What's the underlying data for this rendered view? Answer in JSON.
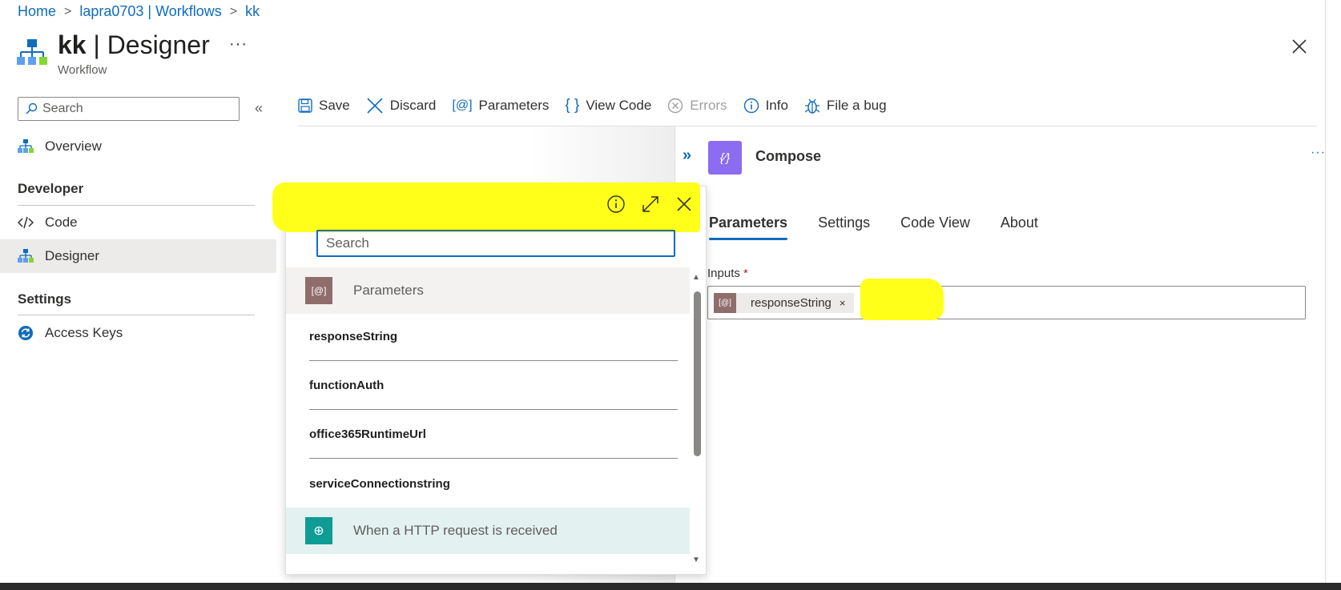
{
  "breadcrumb": {
    "items": [
      "Home",
      "lapra0703 | Workflows",
      "kk"
    ],
    "separator": ">"
  },
  "header": {
    "title_bold": "kk",
    "title_rest": " | Designer",
    "subtitle": "Workflow",
    "more": "···"
  },
  "sidebar": {
    "search_placeholder": "Search",
    "collapse": "«",
    "items": [
      {
        "label": "Overview",
        "icon": "hierarchy-icon"
      },
      {
        "label": "Code",
        "icon": "code-icon"
      },
      {
        "label": "Designer",
        "icon": "hierarchy-icon",
        "selected": true
      },
      {
        "label": "Access Keys",
        "icon": "sync-icon"
      }
    ],
    "sections": [
      "Developer",
      "Settings"
    ]
  },
  "toolbar": {
    "save": "Save",
    "discard": "Discard",
    "parameters": "Parameters",
    "parameters_icon_text": "[@]",
    "view_code": "View Code",
    "view_code_icon_text": "{ }",
    "errors": "Errors",
    "info": "Info",
    "file_bug": "File a bug"
  },
  "panel": {
    "title": "Compose",
    "icon_text": "{⁄}",
    "expand": "»",
    "more": "···",
    "tabs": [
      "Parameters",
      "Settings",
      "Code View",
      "About"
    ],
    "active_tab": "Parameters",
    "inputs_label": "Inputs",
    "required_mark": "*",
    "token": {
      "label": "responseString",
      "icon_text": "[@]",
      "remove": "×"
    }
  },
  "popup": {
    "search_placeholder": "Search",
    "groups": [
      {
        "label": "Parameters",
        "icon_text": "[@]",
        "color": "#8f6d6b"
      },
      {
        "label": "When a HTTP request is received",
        "icon_text": "⊕",
        "color": "#0e9c95"
      }
    ],
    "parameters": [
      "responseString",
      "functionAuth",
      "office365RuntimeUrl",
      "serviceConnectionstring"
    ],
    "scroll_up": "▲",
    "scroll_down": "▼"
  },
  "colors": {
    "accent": "#0f6cbd",
    "highlight": "#ffff1a",
    "compose": "#8c6cf0",
    "parameter_token": "#8f6d6b",
    "http_trigger": "#0e9c95"
  }
}
